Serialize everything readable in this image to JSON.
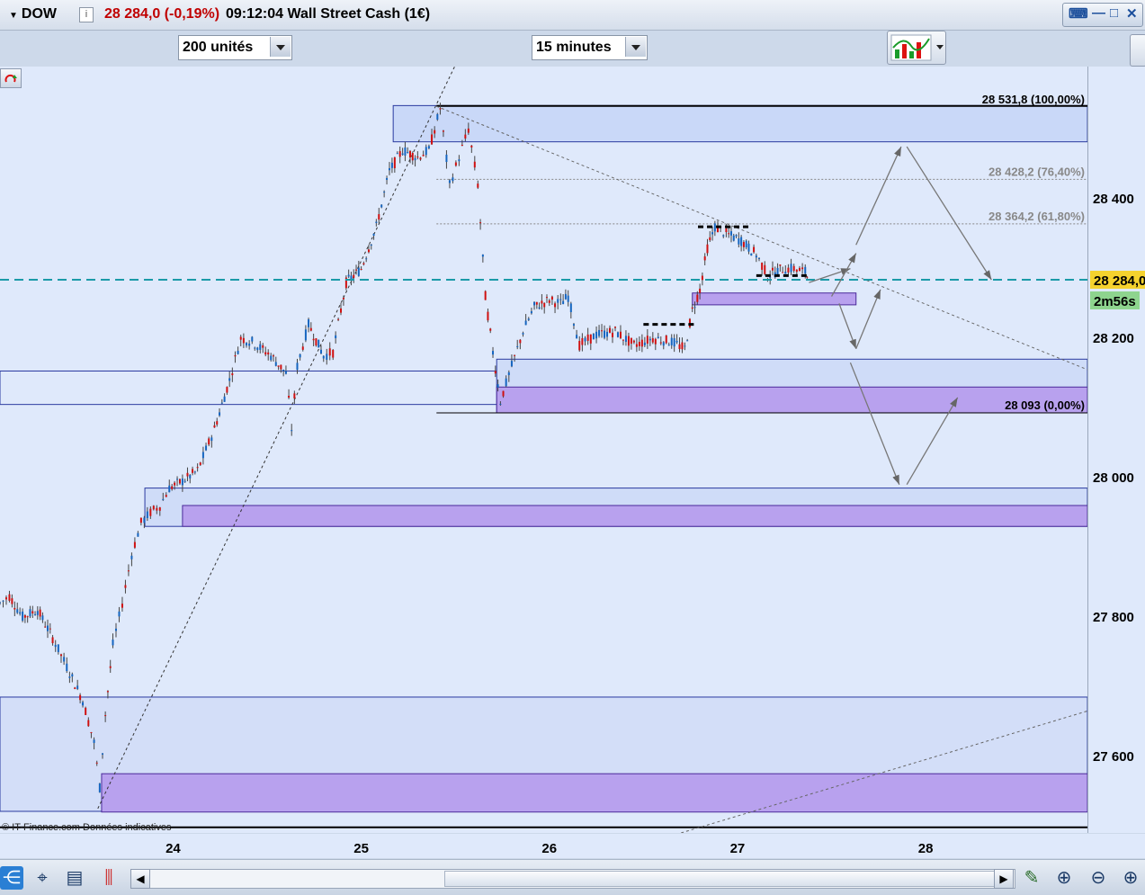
{
  "header": {
    "symbol": "DOW",
    "price_change": "28 284,0 (-0,19%)",
    "time_title": "09:12:04 Wall Street Cash (1€)",
    "info_icon": "i"
  },
  "toolbar": {
    "units_select": "200 unités",
    "interval_select": "15 minutes"
  },
  "chart_data": {
    "type": "candlestick",
    "instrument": "Wall Street Cash (1€)",
    "interval": "15 minutes",
    "source_note": "© IT-Finance.com  Données indicatives",
    "x_tick_labels": [
      "24",
      "25",
      "26",
      "27",
      "28"
    ],
    "y_tick_labels": [
      "28 400",
      "28 200",
      "28 000",
      "27 800",
      "27 600"
    ],
    "y_ticks": [
      28400,
      28200,
      28000,
      27800,
      27600
    ],
    "ylim": [
      27490,
      28590
    ],
    "xlim": [
      23.08,
      28.86
    ],
    "current_price_label": "28 284,0",
    "countdown_label": "2m56s",
    "current_price": 28284,
    "fibonacci_levels": [
      {
        "label": "28 531,8 (100,00%)",
        "value": 28531.8
      },
      {
        "label": "28 428,2 (76,40%)",
        "value": 28428.2
      },
      {
        "label": "28 364,2 (61,80%)",
        "value": 28364.2
      },
      {
        "label": "28 093 (0,00%)",
        "value": 28093
      }
    ],
    "price_path": [
      [
        23.08,
        27820
      ],
      [
        23.13,
        27830
      ],
      [
        23.2,
        27800
      ],
      [
        23.28,
        27810
      ],
      [
        23.36,
        27770
      ],
      [
        23.45,
        27720
      ],
      [
        23.52,
        27680
      ],
      [
        23.58,
        27620
      ],
      [
        23.61,
        27555
      ],
      [
        23.64,
        27660
      ],
      [
        23.68,
        27760
      ],
      [
        23.73,
        27820
      ],
      [
        23.78,
        27890
      ],
      [
        23.83,
        27935
      ],
      [
        23.88,
        27950
      ],
      [
        23.93,
        27960
      ],
      [
        23.98,
        27985
      ],
      [
        24.05,
        27995
      ],
      [
        24.13,
        28010
      ],
      [
        24.22,
        28070
      ],
      [
        24.3,
        28140
      ],
      [
        24.36,
        28200
      ],
      [
        24.42,
        28195
      ],
      [
        24.52,
        28175
      ],
      [
        24.6,
        28150
      ],
      [
        24.63,
        28070
      ],
      [
        24.66,
        28160
      ],
      [
        24.72,
        28220
      ],
      [
        24.8,
        28175
      ],
      [
        24.85,
        28180
      ],
      [
        24.92,
        28280
      ],
      [
        25.0,
        28300
      ],
      [
        25.08,
        28360
      ],
      [
        25.15,
        28440
      ],
      [
        25.22,
        28470
      ],
      [
        25.3,
        28460
      ],
      [
        25.36,
        28470
      ],
      [
        25.42,
        28530
      ],
      [
        25.47,
        28420
      ],
      [
        25.52,
        28460
      ],
      [
        25.57,
        28500
      ],
      [
        25.62,
        28420
      ],
      [
        25.66,
        28260
      ],
      [
        25.7,
        28180
      ],
      [
        25.74,
        28110
      ],
      [
        25.8,
        28160
      ],
      [
        25.86,
        28210
      ],
      [
        25.92,
        28245
      ],
      [
        26.0,
        28255
      ],
      [
        26.06,
        28250
      ],
      [
        26.1,
        28260
      ],
      [
        26.16,
        28190
      ],
      [
        26.25,
        28205
      ],
      [
        26.35,
        28210
      ],
      [
        26.45,
        28190
      ],
      [
        26.55,
        28200
      ],
      [
        26.65,
        28195
      ],
      [
        26.72,
        28185
      ],
      [
        26.76,
        28240
      ],
      [
        26.8,
        28270
      ],
      [
        26.84,
        28330
      ],
      [
        26.88,
        28360
      ],
      [
        26.94,
        28350
      ],
      [
        27.02,
        28340
      ],
      [
        27.1,
        28320
      ],
      [
        27.16,
        28290
      ],
      [
        27.24,
        28300
      ],
      [
        27.3,
        28300
      ],
      [
        27.36,
        28295
      ],
      [
        27.38,
        28284
      ]
    ],
    "zones": [
      {
        "from": 28482,
        "to": 28534,
        "x0": 25.17,
        "x1": 28.86
      },
      {
        "from": 28093,
        "to": 28130,
        "x0": 25.72,
        "x1": 28.86
      },
      {
        "from": 27930,
        "to": 27960,
        "x0": 24.05,
        "x1": 28.86
      },
      {
        "from": 27520,
        "to": 27575,
        "x0": 23.62,
        "x1": 28.86
      },
      {
        "from": 28248,
        "to": 28265,
        "x0": 26.76,
        "x1": 27.63
      }
    ],
    "horizontal_lines": [
      28533.5,
      28153,
      28105,
      28170,
      27930,
      27985,
      27685,
      27521,
      27498
    ]
  },
  "bottom": {
    "icons": [
      "share-icon",
      "crosshair-icon",
      "list-icon",
      "candles-icon",
      "scroll-left",
      "scroll-right",
      "draw-tool-icon",
      "zoom-fit-icon",
      "zoom-out-icon",
      "zoom-in-icon"
    ]
  }
}
